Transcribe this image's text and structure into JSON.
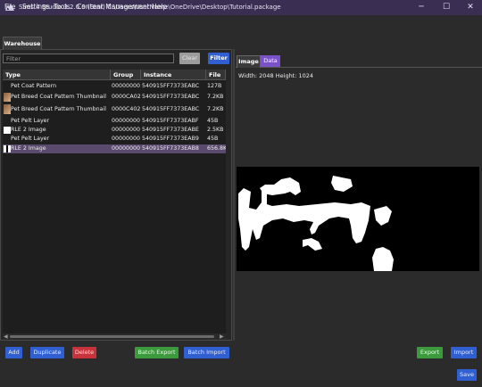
{
  "window": {
    "title": "Sims 4 Studio 3.2.0.9 (Star)  C:\\Users\\UserName\\OneDrive\\Desktop\\Tutorial.package",
    "controls": {
      "minimize": "─",
      "maximize": "☐",
      "close": "✕"
    }
  },
  "menu": {
    "items": [
      "File",
      "Settings",
      "Tools",
      "Content Management",
      "Help"
    ]
  },
  "left": {
    "tab": "Warehouse",
    "filter_placeholder": "Filter",
    "clear_label": "Clear",
    "filter_label": "Filter",
    "columns": [
      "Type",
      "Group",
      "Instance",
      "File"
    ],
    "rows": [
      {
        "type": "Pet Coat Pattern",
        "group": "00000000",
        "instance": "540915FF7373EABC",
        "file": "127B",
        "thumb": "none",
        "selected": false
      },
      {
        "type": "Pet Breed Coat Pattern Thumbnail",
        "group": "0000CA02",
        "instance": "540915FF7373EABC",
        "file": "7.2KB",
        "thumb": "dog-thumbnail",
        "selected": false
      },
      {
        "type": "Pet Breed Coat Pattern Thumbnail",
        "group": "0000C402",
        "instance": "540915FF7373EABC",
        "file": "7.2KB",
        "thumb": "dog-thumbnail",
        "selected": false
      },
      {
        "type": "Pet Pelt Layer",
        "group": "00000000",
        "instance": "540915FF7373EABF",
        "file": "45B",
        "thumb": "none",
        "selected": false
      },
      {
        "type": "RLE 2 Image",
        "group": "00000000",
        "instance": "540915FF7373EABE",
        "file": "2.5KB",
        "thumb": "white-thumbnail",
        "selected": false
      },
      {
        "type": "Pet Pelt Layer",
        "group": "00000000",
        "instance": "540915FF7373EAB9",
        "file": "45B",
        "thumb": "none",
        "selected": false
      },
      {
        "type": "RLE 2 Image",
        "group": "00000000",
        "instance": "540915FF7373EAB8",
        "file": "656.8K",
        "thumb": "bw-thumbnail",
        "selected": true
      }
    ]
  },
  "right": {
    "tabs": [
      "Image",
      "Data"
    ],
    "active_tab": "Data",
    "dimensions_text": "Width: 2048 Height: 1024"
  },
  "buttons": {
    "add": "Add",
    "duplicate": "Duplicate",
    "delete": "Delete",
    "batch_export": "Batch Export",
    "batch_import": "Batch Import",
    "export": "Export",
    "import": "Import",
    "save": "Save"
  },
  "colors": {
    "titlebar": "#3a2f53",
    "accent_purple": "#7a52c7",
    "selected_row": "#5a4a6e",
    "primary_blue": "#2f5fd0",
    "delete_red": "#c8323a",
    "export_green": "#3b9a3b"
  }
}
